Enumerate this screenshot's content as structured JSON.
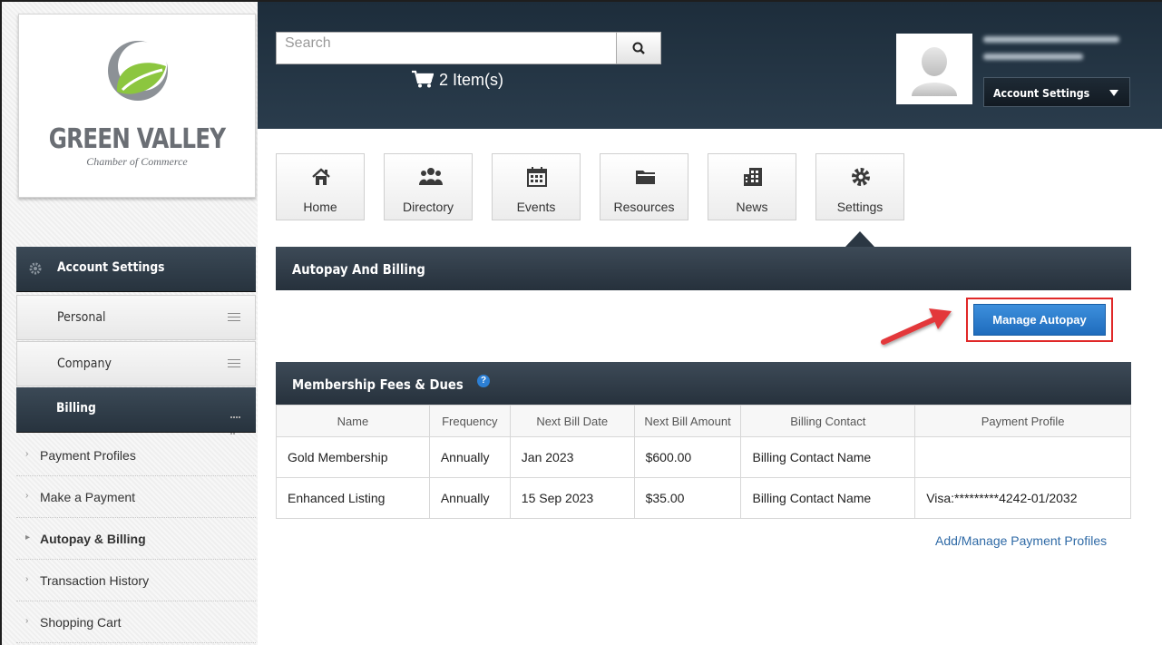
{
  "logo": {
    "title": "GREEN VALLEY",
    "subtitle": "Chamber of Commerce"
  },
  "header": {
    "search": {
      "placeholder": "Search"
    },
    "cart": {
      "label": "2 Item(s)"
    },
    "account_button": "Account Settings"
  },
  "nav": {
    "tiles": [
      {
        "label": "Home",
        "icon": "home-icon"
      },
      {
        "label": "Directory",
        "icon": "people-icon"
      },
      {
        "label": "Events",
        "icon": "calendar-icon"
      },
      {
        "label": "Resources",
        "icon": "folder-icon"
      },
      {
        "label": "News",
        "icon": "news-icon"
      },
      {
        "label": "Settings",
        "icon": "gear-icon"
      }
    ],
    "active": "Settings"
  },
  "sidebar": {
    "header": "Account Settings",
    "groups": [
      {
        "label": "Personal"
      },
      {
        "label": "Company"
      },
      {
        "label": "Billing"
      }
    ],
    "billing_items": [
      {
        "label": "Payment Profiles"
      },
      {
        "label": "Make a Payment"
      },
      {
        "label": "Autopay & Billing"
      },
      {
        "label": "Transaction History"
      },
      {
        "label": "Shopping Cart"
      }
    ],
    "active_item": "Autopay & Billing"
  },
  "autopay": {
    "title": "Autopay And Billing",
    "manage_button": "Manage Autopay"
  },
  "fees": {
    "title": "Membership Fees & Dues",
    "help": "?",
    "columns": [
      "Name",
      "Frequency",
      "Next Bill Date",
      "Next Bill Amount",
      "Billing Contact",
      "Payment Profile"
    ],
    "rows": [
      [
        "Gold Membership",
        "Annually",
        "Jan 2023",
        "$600.00",
        "Billing Contact Name",
        ""
      ],
      [
        "Enhanced Listing",
        "Annually",
        "15 Sep 2023",
        "$35.00",
        "Billing Contact Name",
        "Visa:*********4242-01/2032"
      ]
    ],
    "add_link": "Add/Manage Payment Profiles"
  },
  "colors": {
    "header_bg": "#1d2d3b",
    "section_bg": "#33404c",
    "button_blue": "#2a7acb",
    "highlight_red": "#e02828",
    "logo_green": "#8cc63f",
    "link": "#2f6aa6"
  }
}
